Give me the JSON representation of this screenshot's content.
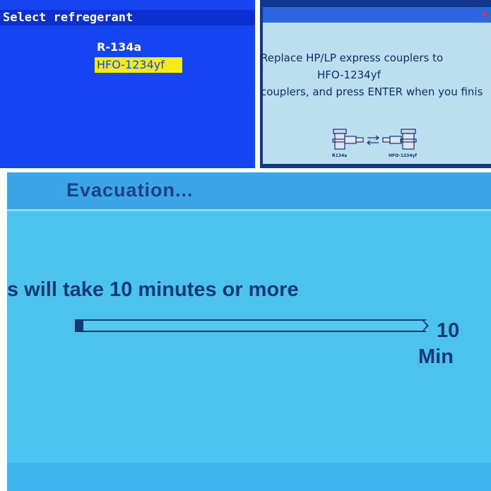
{
  "select_screen": {
    "title": "Select refregerant",
    "options": [
      {
        "label": "R-134a",
        "selected": false
      },
      {
        "label": "HFO-1234yf",
        "selected": true
      }
    ],
    "highlight_color": "#f5eb17"
  },
  "coupler_screen": {
    "line1": "Replace HP/LP express couplers to",
    "line2": "HFO-1234yf",
    "line3": "couplers, and press ENTER when you finis",
    "diagram_labels": {
      "left": "R134a",
      "right": "HFO-1234yf"
    }
  },
  "evacuation_screen": {
    "title": "Evacuation...",
    "message": "s will take 10 minutes or more",
    "progress_fraction": 0.02,
    "time_value": "10",
    "time_unit": "Min"
  }
}
